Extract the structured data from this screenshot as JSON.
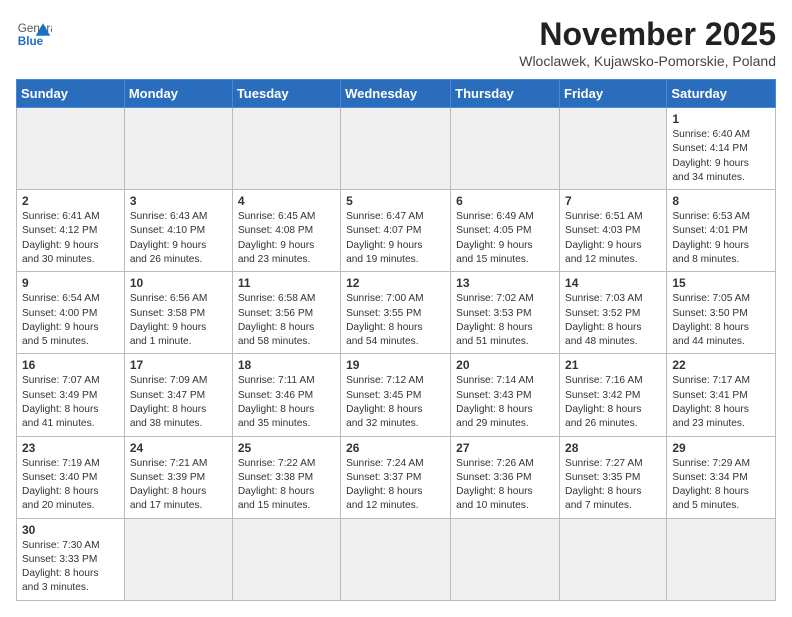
{
  "header": {
    "logo_general": "General",
    "logo_blue": "Blue",
    "month_title": "November 2025",
    "location": "Wloclawek, Kujawsko-Pomorskie, Poland"
  },
  "weekdays": [
    "Sunday",
    "Monday",
    "Tuesday",
    "Wednesday",
    "Thursday",
    "Friday",
    "Saturday"
  ],
  "weeks": [
    [
      {
        "day": "",
        "info": ""
      },
      {
        "day": "",
        "info": ""
      },
      {
        "day": "",
        "info": ""
      },
      {
        "day": "",
        "info": ""
      },
      {
        "day": "",
        "info": ""
      },
      {
        "day": "",
        "info": ""
      },
      {
        "day": "1",
        "info": "Sunrise: 6:40 AM\nSunset: 4:14 PM\nDaylight: 9 hours\nand 34 minutes."
      }
    ],
    [
      {
        "day": "2",
        "info": "Sunrise: 6:41 AM\nSunset: 4:12 PM\nDaylight: 9 hours\nand 30 minutes."
      },
      {
        "day": "3",
        "info": "Sunrise: 6:43 AM\nSunset: 4:10 PM\nDaylight: 9 hours\nand 26 minutes."
      },
      {
        "day": "4",
        "info": "Sunrise: 6:45 AM\nSunset: 4:08 PM\nDaylight: 9 hours\nand 23 minutes."
      },
      {
        "day": "5",
        "info": "Sunrise: 6:47 AM\nSunset: 4:07 PM\nDaylight: 9 hours\nand 19 minutes."
      },
      {
        "day": "6",
        "info": "Sunrise: 6:49 AM\nSunset: 4:05 PM\nDaylight: 9 hours\nand 15 minutes."
      },
      {
        "day": "7",
        "info": "Sunrise: 6:51 AM\nSunset: 4:03 PM\nDaylight: 9 hours\nand 12 minutes."
      },
      {
        "day": "8",
        "info": "Sunrise: 6:53 AM\nSunset: 4:01 PM\nDaylight: 9 hours\nand 8 minutes."
      }
    ],
    [
      {
        "day": "9",
        "info": "Sunrise: 6:54 AM\nSunset: 4:00 PM\nDaylight: 9 hours\nand 5 minutes."
      },
      {
        "day": "10",
        "info": "Sunrise: 6:56 AM\nSunset: 3:58 PM\nDaylight: 9 hours\nand 1 minute."
      },
      {
        "day": "11",
        "info": "Sunrise: 6:58 AM\nSunset: 3:56 PM\nDaylight: 8 hours\nand 58 minutes."
      },
      {
        "day": "12",
        "info": "Sunrise: 7:00 AM\nSunset: 3:55 PM\nDaylight: 8 hours\nand 54 minutes."
      },
      {
        "day": "13",
        "info": "Sunrise: 7:02 AM\nSunset: 3:53 PM\nDaylight: 8 hours\nand 51 minutes."
      },
      {
        "day": "14",
        "info": "Sunrise: 7:03 AM\nSunset: 3:52 PM\nDaylight: 8 hours\nand 48 minutes."
      },
      {
        "day": "15",
        "info": "Sunrise: 7:05 AM\nSunset: 3:50 PM\nDaylight: 8 hours\nand 44 minutes."
      }
    ],
    [
      {
        "day": "16",
        "info": "Sunrise: 7:07 AM\nSunset: 3:49 PM\nDaylight: 8 hours\nand 41 minutes."
      },
      {
        "day": "17",
        "info": "Sunrise: 7:09 AM\nSunset: 3:47 PM\nDaylight: 8 hours\nand 38 minutes."
      },
      {
        "day": "18",
        "info": "Sunrise: 7:11 AM\nSunset: 3:46 PM\nDaylight: 8 hours\nand 35 minutes."
      },
      {
        "day": "19",
        "info": "Sunrise: 7:12 AM\nSunset: 3:45 PM\nDaylight: 8 hours\nand 32 minutes."
      },
      {
        "day": "20",
        "info": "Sunrise: 7:14 AM\nSunset: 3:43 PM\nDaylight: 8 hours\nand 29 minutes."
      },
      {
        "day": "21",
        "info": "Sunrise: 7:16 AM\nSunset: 3:42 PM\nDaylight: 8 hours\nand 26 minutes."
      },
      {
        "day": "22",
        "info": "Sunrise: 7:17 AM\nSunset: 3:41 PM\nDaylight: 8 hours\nand 23 minutes."
      }
    ],
    [
      {
        "day": "23",
        "info": "Sunrise: 7:19 AM\nSunset: 3:40 PM\nDaylight: 8 hours\nand 20 minutes."
      },
      {
        "day": "24",
        "info": "Sunrise: 7:21 AM\nSunset: 3:39 PM\nDaylight: 8 hours\nand 17 minutes."
      },
      {
        "day": "25",
        "info": "Sunrise: 7:22 AM\nSunset: 3:38 PM\nDaylight: 8 hours\nand 15 minutes."
      },
      {
        "day": "26",
        "info": "Sunrise: 7:24 AM\nSunset: 3:37 PM\nDaylight: 8 hours\nand 12 minutes."
      },
      {
        "day": "27",
        "info": "Sunrise: 7:26 AM\nSunset: 3:36 PM\nDaylight: 8 hours\nand 10 minutes."
      },
      {
        "day": "28",
        "info": "Sunrise: 7:27 AM\nSunset: 3:35 PM\nDaylight: 8 hours\nand 7 minutes."
      },
      {
        "day": "29",
        "info": "Sunrise: 7:29 AM\nSunset: 3:34 PM\nDaylight: 8 hours\nand 5 minutes."
      }
    ],
    [
      {
        "day": "30",
        "info": "Sunrise: 7:30 AM\nSunset: 3:33 PM\nDaylight: 8 hours\nand 3 minutes."
      },
      {
        "day": "",
        "info": ""
      },
      {
        "day": "",
        "info": ""
      },
      {
        "day": "",
        "info": ""
      },
      {
        "day": "",
        "info": ""
      },
      {
        "day": "",
        "info": ""
      },
      {
        "day": "",
        "info": ""
      }
    ]
  ]
}
